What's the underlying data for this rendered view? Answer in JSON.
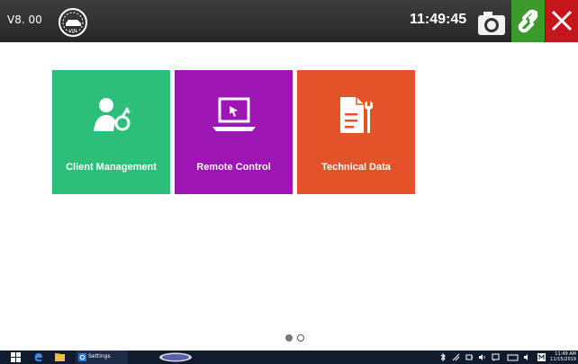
{
  "header": {
    "version": "V8. 00",
    "vin_badge": "VIN",
    "time": "11:49:45",
    "icons": [
      "vin-gauge-icon",
      "camera-icon",
      "link-icon",
      "close-icon"
    ],
    "colors": {
      "bar": "#2e2e2e",
      "link": "#3a9a2a",
      "close": "#c5161d"
    }
  },
  "tiles": [
    {
      "label": "Client Management",
      "icon": "client-management-icon",
      "color": "#2bbf7a"
    },
    {
      "label": "Remote Control",
      "icon": "laptop-icon",
      "color": "#9d16b4"
    },
    {
      "label": "Technical Data",
      "icon": "document-wrench-icon",
      "color": "#e3532a"
    }
  ],
  "pager": {
    "pages": 2,
    "current": 1
  },
  "taskbar": {
    "settings_label": "Settings",
    "time": "11:49 AM",
    "date": "11/15/2019",
    "icons": [
      "windows-start-icon",
      "edge-icon",
      "file-explorer-icon",
      "settings-icon",
      "app-logo-icon",
      "bluetooth-icon",
      "network-icon",
      "battery-icon",
      "volume-icon",
      "notification-icon",
      "keyboard-icon",
      "language-icon"
    ]
  }
}
